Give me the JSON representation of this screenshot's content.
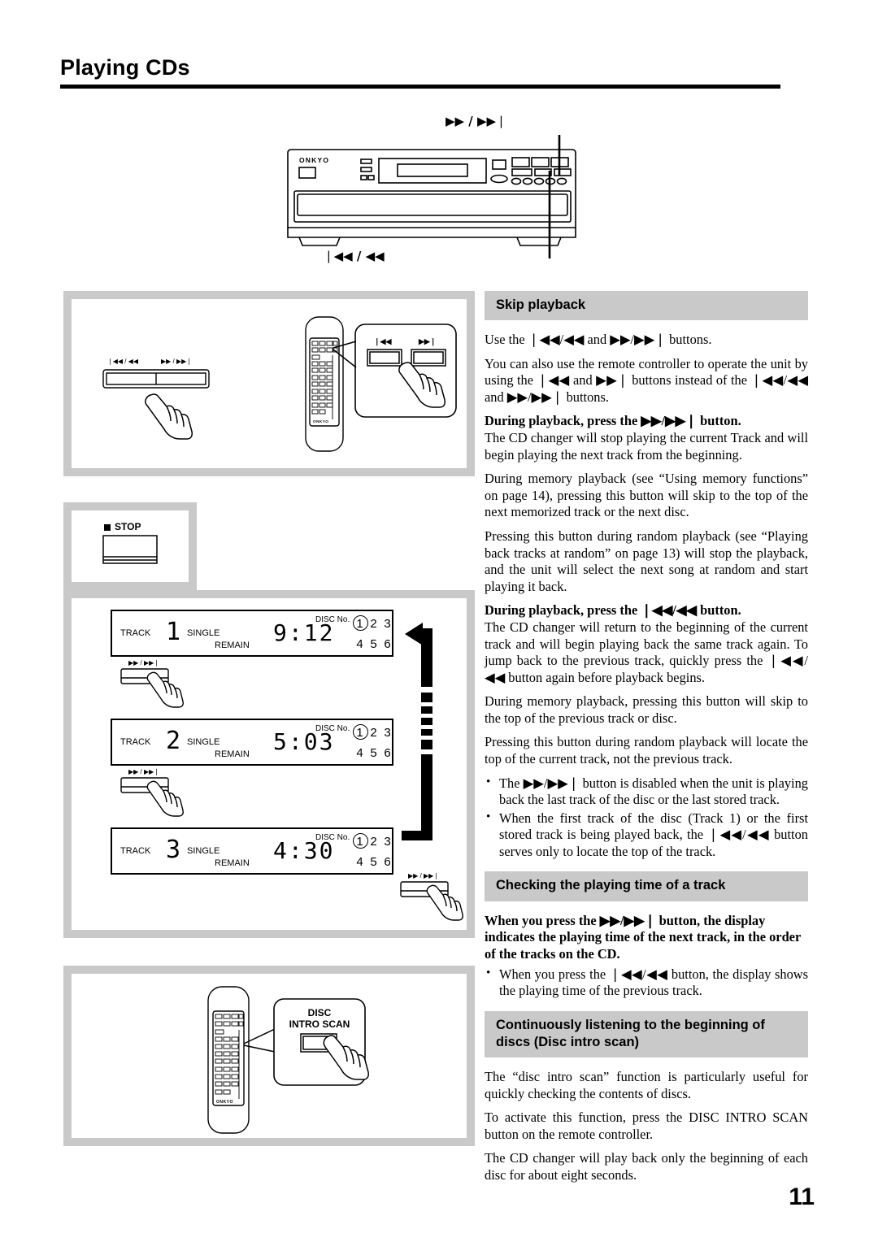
{
  "page": {
    "title": "Playing CDs",
    "number": "11"
  },
  "unit_figure": {
    "brand": "ONKYO",
    "callout_top": "▶▶ / ▶▶❘",
    "callout_bottom": "❘◀◀ / ◀◀"
  },
  "figures": {
    "skip": {
      "unit_button_left_label": "❘◀◀ / ◀◀",
      "unit_button_right_label": "▶▶ / ▶▶❘",
      "remote_brand": "ONKYO",
      "callout_prev_label": "❘◀◀",
      "callout_next_label": "▶▶❘"
    },
    "stop": {
      "label": "STOP",
      "icon": "stop-square-icon"
    },
    "displays": {
      "items": [
        {
          "track_label": "TRACK",
          "track_number": "1",
          "single_label": "SINGLE",
          "remain_label": "REMAIN",
          "time": "9:12",
          "disc_no_label": "DISC No.",
          "discs": [
            "1",
            "2",
            "3",
            "4",
            "5",
            "6"
          ],
          "selected_disc": "1"
        },
        {
          "track_label": "TRACK",
          "track_number": "2",
          "single_label": "SINGLE",
          "remain_label": "REMAIN",
          "time": "5:03",
          "disc_no_label": "DISC No.",
          "discs": [
            "1",
            "2",
            "3",
            "4",
            "5",
            "6"
          ],
          "selected_disc": "1"
        },
        {
          "track_label": "TRACK",
          "track_number": "3",
          "single_label": "SINGLE",
          "remain_label": "REMAIN",
          "time": "4:30",
          "disc_no_label": "DISC No.",
          "discs": [
            "1",
            "2",
            "3",
            "4",
            "5",
            "6"
          ],
          "selected_disc": "1"
        }
      ],
      "press_button_label": "▶▶ / ▶▶❘"
    },
    "intro_scan": {
      "remote_brand": "ONKYO",
      "callout_line1": "DISC",
      "callout_line2": "INTRO SCAN"
    }
  },
  "sections": [
    {
      "heading": "Skip playback",
      "paragraphs": [
        "Use the ❘◀◀/◀◀ and ▶▶/▶▶❘ buttons.",
        "You can also use the remote controller to operate the unit by using the ❘◀◀ and ▶▶❘ buttons instead of the ❘◀◀/◀◀ and ▶▶/▶▶❘ buttons."
      ],
      "lead1": "During playback, press the ▶▶/▶▶❘ button.",
      "body1": [
        "The CD changer will stop playing the current Track and will begin playing the next track from the beginning.",
        "During memory playback (see “Using memory functions” on page 14), pressing this button will skip to the top of the next memorized track or the next disc.",
        "Pressing this button during random playback (see “Playing back tracks at random” on page 13) will stop the playback, and the unit will select the next song at random and start playing it back."
      ],
      "lead2": "During playback, press the ❘◀◀/◀◀ button.",
      "body2": [
        "The CD changer will return to the beginning of the current track and will begin playing back the same track again. To jump back to the previous track, quickly press the ❘◀◀/◀◀ button again before playback begins.",
        "During memory playback, pressing this button will skip to the top of the previous track or disc.",
        "Pressing this button during random playback will locate the top of the current track, not the previous track."
      ],
      "bullets": [
        "The ▶▶/▶▶❘ button is disabled when the unit is playing back the last track of the disc or the last stored track.",
        "When the first track of the disc (Track 1) or the first stored track is being played back, the ❘◀◀/◀◀ button serves only to locate the top of the track."
      ]
    },
    {
      "heading": "Checking the playing time of a track",
      "lead1": "When you press the ▶▶/▶▶❘ button, the display indicates the playing time of the next track, in the order of the tracks on the CD.",
      "bullets": [
        "When you press the ❘◀◀/◀◀ button, the display shows the playing time of the previous track."
      ]
    },
    {
      "heading": "Continuously listening to the beginning of discs (Disc intro scan)",
      "paragraphs": [
        "The “disc intro scan” function is particularly useful for quickly checking the contents of discs.",
        "To activate this function, press the DISC INTRO SCAN button on the remote controller.",
        "The CD changer will play back only the beginning of each disc for about eight seconds."
      ]
    }
  ]
}
